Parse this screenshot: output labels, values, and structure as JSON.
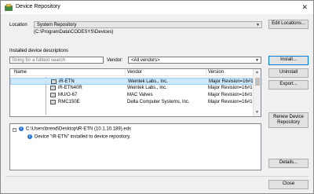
{
  "window": {
    "title": "Device Repository",
    "close_glyph": "✕"
  },
  "location": {
    "label": "Location",
    "value": "System Repository",
    "path": "(C:\\ProgramData\\CODESYS\\Devices)",
    "edit_button": "Edit Locations..."
  },
  "installed": {
    "label": "Installed device descriptions",
    "search_placeholder": "String for a fulltext search",
    "vendor_label": "Vendor:",
    "vendor_value": "<All vendors>",
    "columns": [
      "Name",
      "Vendor",
      "Version"
    ],
    "rows": [
      {
        "name": "iR-ETN",
        "vendor": "Weintek Labs., Inc.",
        "version": "Major Revision=16#1,",
        "selected": true
      },
      {
        "name": "iR-ETN40R",
        "vendor": "Weintek Labs., Inc.",
        "version": "Major Revision=16#1,"
      },
      {
        "name": "MU/O-67",
        "vendor": "MAC Valves",
        "version": "Major Revision=16#1,"
      },
      {
        "name": "RMC150E",
        "vendor": "Delta Computer Systems, Inc.",
        "version": "Major Revision=16#1,"
      }
    ]
  },
  "buttons": {
    "install": "Install...",
    "uninstall": "Uninstall",
    "export": "Export...",
    "renew": "Renew Device Repository",
    "details": "Details...",
    "close": "Close"
  },
  "messages": {
    "file": "C:\\Users\\brend\\Desktop\\iR-ETN (10.1.10.189).eds",
    "status": "Device \"iR-ETN\" installed to device repository."
  },
  "icons": {
    "app": "repository-icon",
    "info": "info-icon"
  },
  "colors": {
    "selection": "#cce8ff",
    "info_blue": "#1e6fd9",
    "default_button_border": "#0078d7"
  }
}
